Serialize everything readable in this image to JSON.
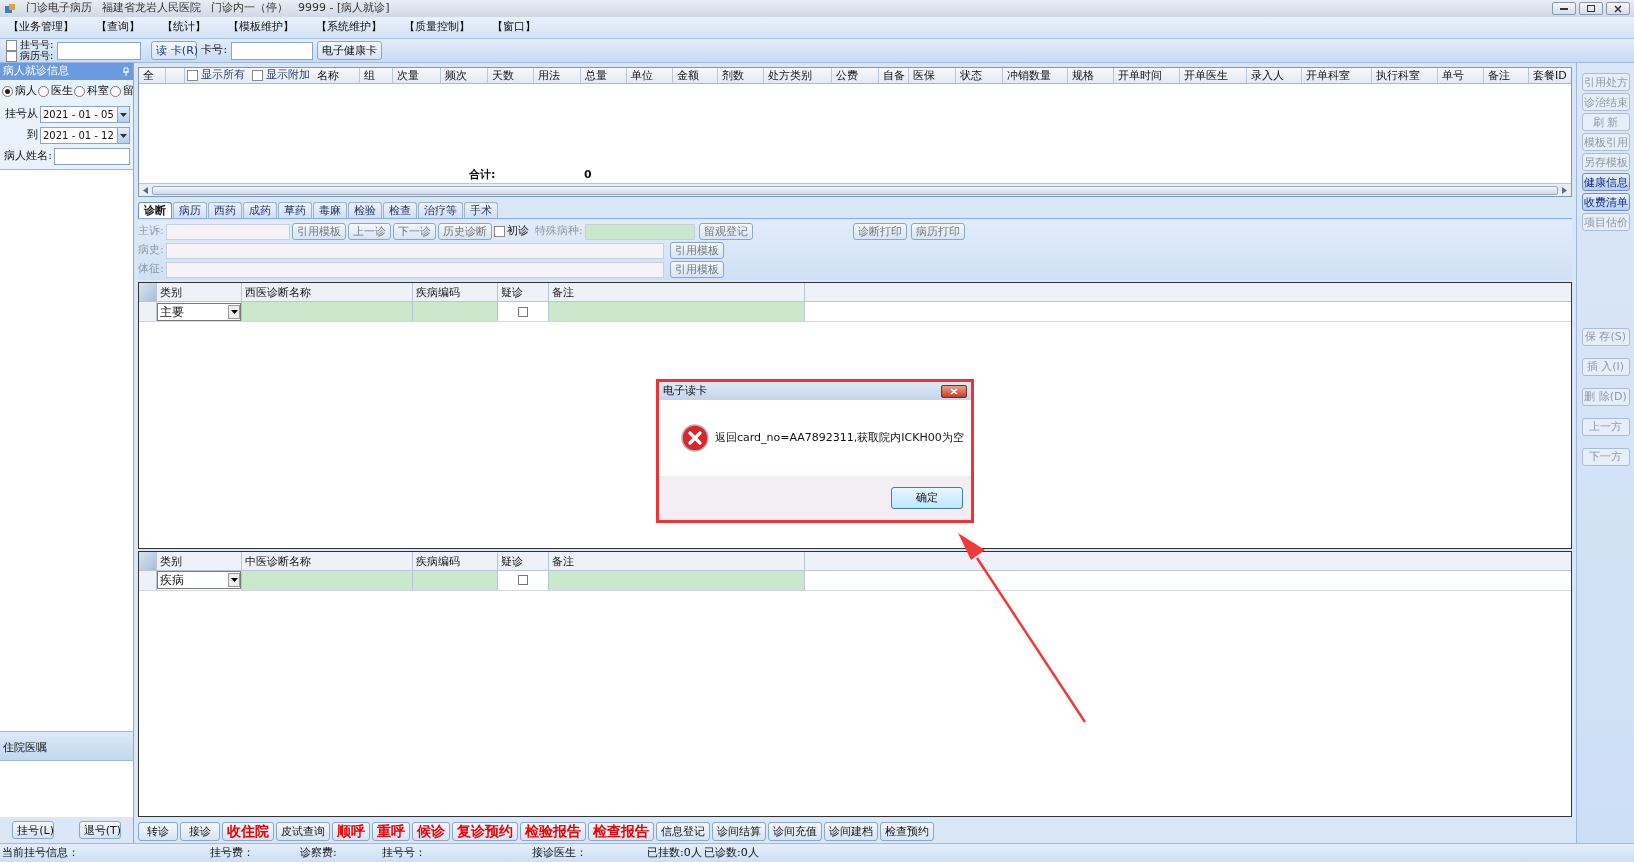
{
  "window": {
    "title_parts": [
      "门诊电子病历",
      "福建省龙岩人民医院",
      "门诊内一（停）",
      "9999 - [病人就诊]"
    ]
  },
  "menu": [
    "【业务管理】",
    "【查询】",
    "【统计】",
    "【模板维护】",
    "【系统维护】",
    "【质量控制】",
    "【窗口】"
  ],
  "toolbar": {
    "checks": [
      {
        "label": "挂号号:",
        "checked": false
      },
      {
        "label": "病历号:",
        "checked": false
      }
    ],
    "read_card_button": "读 卡(R)",
    "card_label": "卡号:",
    "health_card_button": "电子健康卡"
  },
  "left_panel": {
    "title": "病人就诊信息",
    "radios": [
      {
        "label": "病人",
        "selected": true
      },
      {
        "label": "医生",
        "selected": false
      },
      {
        "label": "科室",
        "selected": false
      },
      {
        "label": "留",
        "selected": false
      }
    ],
    "date_from_label": "挂号从",
    "date_from": "2021 - 01 - 05",
    "date_to_label": "到",
    "date_to": "2021 - 01 - 12",
    "name_label": "病人姓名:",
    "orders_title": "住院医嘱",
    "buttons": [
      "挂号(L)",
      "退号(T)"
    ]
  },
  "order_grid": {
    "columns": [
      {
        "kind": "text",
        "label": "全"
      },
      {
        "kind": "blank"
      },
      {
        "kind": "check",
        "label": "显示所有",
        "checked": false
      },
      {
        "kind": "check",
        "label": "显示附加",
        "checked": false
      },
      {
        "kind": "text",
        "label": "名称"
      },
      {
        "kind": "text",
        "label": "组"
      },
      {
        "kind": "text",
        "label": "次量"
      },
      {
        "kind": "text",
        "label": "频次"
      },
      {
        "kind": "text",
        "label": "天数"
      },
      {
        "kind": "text",
        "label": "用法"
      },
      {
        "kind": "text",
        "label": "总量"
      },
      {
        "kind": "text",
        "label": "单位"
      },
      {
        "kind": "text",
        "label": "金额"
      },
      {
        "kind": "text",
        "label": "剂数"
      },
      {
        "kind": "text",
        "label": "处方类别"
      },
      {
        "kind": "text",
        "label": "公费"
      },
      {
        "kind": "text",
        "label": "自备"
      },
      {
        "kind": "text",
        "label": "医保"
      },
      {
        "kind": "text",
        "label": "状态"
      },
      {
        "kind": "text",
        "label": "冲销数量"
      },
      {
        "kind": "text",
        "label": "规格"
      },
      {
        "kind": "text",
        "label": "开单时间"
      },
      {
        "kind": "text",
        "label": "开单医生"
      },
      {
        "kind": "text",
        "label": "录入人"
      },
      {
        "kind": "text",
        "label": "开单科室"
      },
      {
        "kind": "text",
        "label": "执行科室"
      },
      {
        "kind": "text",
        "label": "单号"
      },
      {
        "kind": "text",
        "label": "备注"
      },
      {
        "kind": "text",
        "label": "套餐ID"
      }
    ],
    "total_label": "合计:",
    "total_value": "0"
  },
  "tabs": [
    {
      "label": "诊断",
      "selected": true
    },
    {
      "label": "病历",
      "selected": false
    },
    {
      "label": "西药",
      "selected": false
    },
    {
      "label": "成药",
      "selected": false
    },
    {
      "label": "草药",
      "selected": false
    },
    {
      "label": "毒麻",
      "selected": false
    },
    {
      "label": "检验",
      "selected": false
    },
    {
      "label": "检查",
      "selected": false
    },
    {
      "label": "治疗等",
      "selected": false
    },
    {
      "label": "手术",
      "selected": false
    }
  ],
  "form": {
    "complaint_label": "主诉:",
    "buttons": [
      "引用模板",
      "上一诊",
      "下一诊",
      "历史诊断"
    ],
    "first_visit": {
      "label": "初诊",
      "checked": false
    },
    "special_label": "特殊病种:",
    "observe_button": "留观登记",
    "print_buttons": [
      "诊断打印",
      "病历打印"
    ],
    "history_label": "病史:",
    "history_button": "引用模板",
    "signs_label": "体征:",
    "signs_button": "引用模板"
  },
  "western_grid": {
    "columns": [
      "类别",
      "西医诊断名称",
      "疾病编码",
      "疑诊",
      "备注"
    ],
    "row": {
      "category": "主要",
      "suspected": false
    }
  },
  "chinese_grid": {
    "columns": [
      "类别",
      "中医诊断名称",
      "疾病编码",
      "疑诊",
      "备注"
    ],
    "row": {
      "category": "疾病",
      "suspected": false
    }
  },
  "side_buttons_top": [
    {
      "label": "引用处方",
      "disabled": true
    },
    {
      "label": "诊治结束",
      "disabled": true
    },
    {
      "label": "刷 新",
      "disabled": true
    },
    {
      "label": "模板引用",
      "disabled": true
    },
    {
      "label": "另存模板",
      "disabled": true
    },
    {
      "label": "健康信息",
      "disabled": false
    },
    {
      "label": "收费清单",
      "disabled": false
    },
    {
      "label": "项目估价",
      "disabled": true
    }
  ],
  "side_buttons_bottom": [
    {
      "label": "保 存(S)",
      "disabled": true
    },
    {
      "label": "插 入(I)",
      "disabled": true
    },
    {
      "label": "删 除(D)",
      "disabled": true
    },
    {
      "label": "上一方",
      "disabled": true
    },
    {
      "label": "下一方",
      "disabled": true
    }
  ],
  "bottom_buttons": [
    {
      "label": "转诊",
      "kind": "normal"
    },
    {
      "label": "接诊",
      "kind": "normal"
    },
    {
      "label": "收住院",
      "kind": "highlight"
    },
    {
      "label": "皮试查询",
      "kind": "normal"
    },
    {
      "label": "顺呼",
      "kind": "highlight"
    },
    {
      "label": "重呼",
      "kind": "highlight"
    },
    {
      "label": "候诊",
      "kind": "highlight"
    },
    {
      "label": "复诊预约",
      "kind": "highlight"
    },
    {
      "label": "检验报告",
      "kind": "highlight"
    },
    {
      "label": "检查报告",
      "kind": "highlight"
    },
    {
      "label": "信息登记",
      "kind": "normal"
    },
    {
      "label": "诊间结算",
      "kind": "normal"
    },
    {
      "label": "诊间充值",
      "kind": "normal"
    },
    {
      "label": "诊间建档",
      "kind": "normal"
    },
    {
      "label": "检查预约",
      "kind": "normal"
    }
  ],
  "status_bar": [
    "当前挂号信息：",
    "挂号费：",
    "诊察费:",
    "挂号号：",
    "接诊医生：",
    "已挂数:0人",
    "已诊数:0人"
  ],
  "dialog": {
    "title": "电子读卡",
    "message": "返回card_no=AA7892311,获取院内ICKH00为空",
    "ok_button": "确定"
  }
}
